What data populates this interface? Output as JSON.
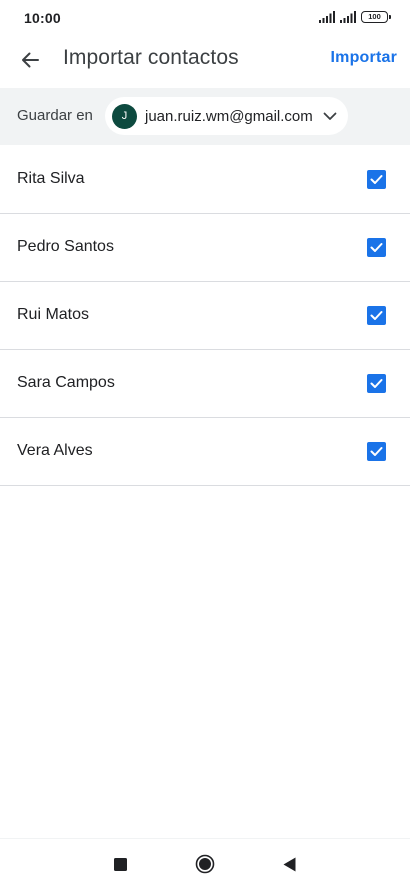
{
  "status_bar": {
    "time": "10:00",
    "battery": "100",
    "icons": [
      "signal-icon",
      "signal-icon",
      "battery-icon"
    ]
  },
  "app_bar": {
    "back_icon": "arrow-back-icon",
    "title": "Importar contactos",
    "action_label": "Importar"
  },
  "account_bar": {
    "label": "Guardar en",
    "avatar_initial": "J",
    "email": "juan.ruiz.wm@gmail.com",
    "chevron_icon": "chevron-down-icon"
  },
  "contacts": [
    {
      "name": "Rita Silva",
      "checked": true
    },
    {
      "name": "Pedro Santos",
      "checked": true
    },
    {
      "name": "Rui Matos",
      "checked": true
    },
    {
      "name": "Sara Campos",
      "checked": true
    },
    {
      "name": "Vera Alves",
      "checked": true
    }
  ],
  "nav_bar": {
    "icons": [
      "recents-square-icon",
      "home-circle-icon",
      "back-triangle-icon"
    ]
  },
  "colors": {
    "accent": "#1a73e8",
    "avatar_bg": "#0d4a3f",
    "account_bar_bg": "#f1f3f4",
    "divider": "#dadce0"
  }
}
